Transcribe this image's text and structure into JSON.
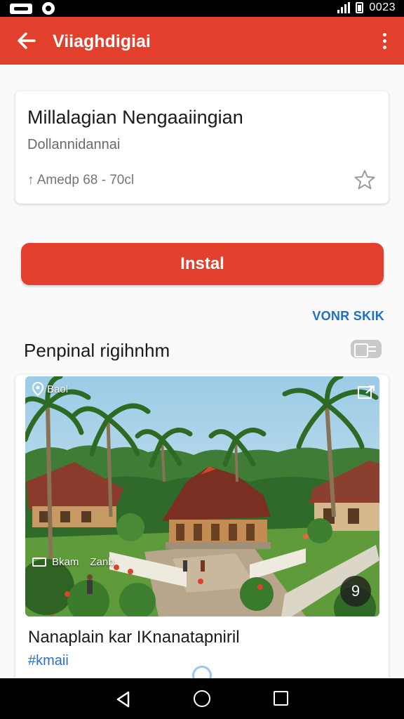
{
  "status_bar": {
    "time": "0023"
  },
  "app_bar": {
    "title": "Viiaghdigiai"
  },
  "app_info": {
    "name": "Millalagian Nengaaiingian",
    "developer": "Dollannidannai",
    "meta": "Amedp 68 - 70cl"
  },
  "install": {
    "label": "Instal"
  },
  "view_more": {
    "label": "VONR SKIK"
  },
  "section": {
    "title": "Penpinal rigihnhm"
  },
  "media": {
    "pin_label": "Baol",
    "caption": "Bkam",
    "caption_tag": "Zanb",
    "count": "9",
    "title": "Nanaplain kar IKnanatapniril",
    "tag": "#kmaii"
  },
  "colors": {
    "accent": "#e2402d",
    "link": "#1b6fd1",
    "tag": "#2b6fce"
  },
  "icons": [
    "back-arrow-icon",
    "overflow-menu-icon",
    "star-icon",
    "toggle-view-icon",
    "map-pin-icon",
    "expand-icon",
    "camera-icon",
    "nav-back-icon",
    "nav-home-icon",
    "nav-recents-icon"
  ]
}
